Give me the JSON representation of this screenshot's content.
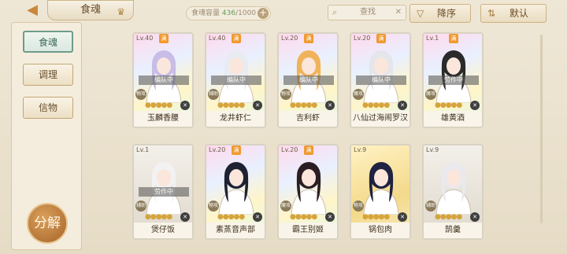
{
  "header": {
    "tab_title": "食魂",
    "capacity_label": "食魂容量",
    "capacity_current": "436",
    "capacity_max": "/1000",
    "search_label": "查找",
    "sort_label": "降序",
    "default_label": "默认",
    "back_icon": "back-arrow-icon",
    "crown_icon": "crown-icon"
  },
  "sidebar": {
    "items": [
      {
        "label": "食魂",
        "active": true
      },
      {
        "label": "调理",
        "active": false
      },
      {
        "label": "信物",
        "active": false
      }
    ],
    "decompose_label": "分解"
  },
  "cards": [
    {
      "level": "Lv.40",
      "badge": "满",
      "status": "编队中",
      "type": "物攻",
      "name": "玉麟香腰",
      "style": "rainbow",
      "hair": "#c7bde6"
    },
    {
      "level": "Lv.40",
      "badge": "满",
      "status": "编队中",
      "type": "辅助",
      "name": "龙井虾仁",
      "style": "rainbow",
      "hair": "#e8ecf2"
    },
    {
      "level": "Lv.20",
      "badge": "满",
      "status": "编队中",
      "type": "物攻",
      "name": "吉利虾",
      "style": "rainbow",
      "hair": "#f0b35a"
    },
    {
      "level": "Lv.20",
      "badge": "满",
      "status": "编队中",
      "type": "魔攻",
      "name": "八仙过海闹罗汉",
      "style": "rainbow",
      "hair": "#e4e6ec"
    },
    {
      "level": "Lv.1",
      "badge": "满",
      "status": "劳作中",
      "type": "魔攻",
      "name": "雄黄酒",
      "style": "rainbow",
      "hair": "#2a2a2a"
    },
    {
      "level": "Lv.1",
      "badge": "",
      "status": "劳作中",
      "type": "辅助",
      "name": "煲仔饭",
      "style": "plain",
      "hair": "#f2f2f2"
    },
    {
      "level": "Lv.20",
      "badge": "满",
      "status": "",
      "type": "物攻",
      "name": "素蒸音声部",
      "style": "rainbow",
      "hair": "#1d2233"
    },
    {
      "level": "Lv.20",
      "badge": "满",
      "status": "",
      "type": "魔攻",
      "name": "霸王别姬",
      "style": "rainbow",
      "hair": "#2a1e22"
    },
    {
      "level": "Lv.9",
      "badge": "",
      "status": "",
      "type": "物攻",
      "name": "锅包肉",
      "style": "gold",
      "hair": "#1f2240"
    },
    {
      "level": "Lv.9",
      "badge": "",
      "status": "",
      "type": "辅助",
      "name": "鹄羹",
      "style": "plain",
      "hair": "#e9e9ee"
    }
  ],
  "colors": {
    "accent": "#c9883c",
    "active_tab": "#6e9c8a",
    "capacity_current": "#5e9e55"
  }
}
